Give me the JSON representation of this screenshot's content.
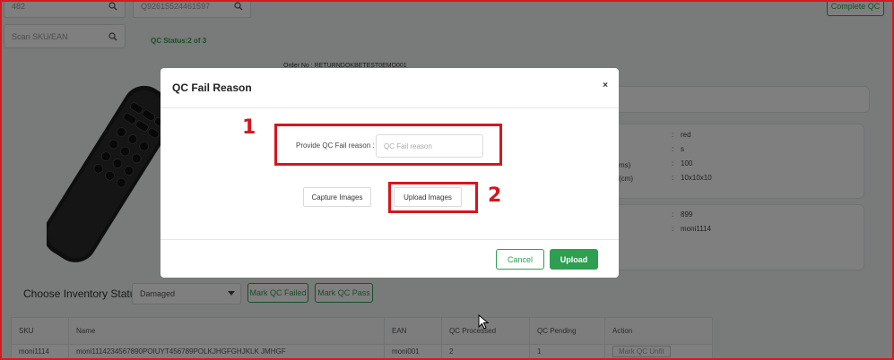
{
  "topbar": {
    "order_field_value": "482",
    "awb_field_value": "Q92615524461597",
    "scan_placeholder": "Scan SKU/EAN",
    "qc_status": "QC Status:2 of 3",
    "complete_qc_label": "Complete QC"
  },
  "order": {
    "label": "Order No : RETURNDOKBETEST0EMO001"
  },
  "details_card": {
    "rows": [
      {
        "key": "",
        "sep": ":",
        "value": "red"
      },
      {
        "key": "",
        "sep": ":",
        "value": "s"
      },
      {
        "key": "ms)",
        "sep": ":",
        "value": "100"
      },
      {
        "key": "(cm)",
        "sep": ":",
        "value": "10x10x10"
      }
    ]
  },
  "price_card": {
    "rows": [
      {
        "sep": ":",
        "value": "899"
      },
      {
        "sep": ":",
        "value": "moni1114"
      }
    ]
  },
  "inventory": {
    "label": "Choose Inventory Status",
    "selected": "Damaged",
    "mark_failed": "Mark QC Failed",
    "mark_pass": "Mark QC Pass"
  },
  "table": {
    "headers": [
      "SKU",
      "Name",
      "EAN",
      "QC Processed",
      "QC Pending",
      "Action"
    ],
    "row": [
      "moni1114",
      "moni1114234567890POIUYT456789POLKJHGFGHJKLK JMHGF",
      "moni001",
      "2",
      "1",
      "Mark QC Unfit"
    ]
  },
  "modal": {
    "title": "QC Fail Reason",
    "close_label": "×",
    "reason_label": "Provide QC Fail reason :",
    "reason_placeholder": "QC Fail reason",
    "capture_label": "Capture Images",
    "upload_images_label": "Upload Images",
    "cancel_label": "Cancel",
    "upload_label": "Upload"
  },
  "annotations": {
    "marker_1": "1",
    "marker_2": "2"
  },
  "colors": {
    "brand_green": "#2e9e51",
    "annotation_red": "#d4161f"
  }
}
